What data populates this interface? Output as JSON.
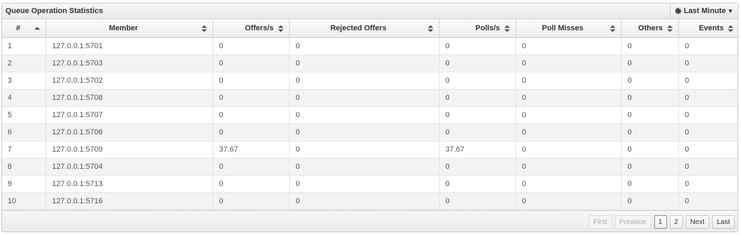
{
  "panel": {
    "title": "Queue Operation Statistics",
    "time_range": "Last Minute",
    "time_range_icon": "gear-icon"
  },
  "table": {
    "columns": [
      "#",
      "Member",
      "Offers/s",
      "Rejected Offers",
      "Polls/s",
      "Poll Misses",
      "Others",
      "Events"
    ],
    "rows": [
      [
        "1",
        "127.0.0.1:5701",
        "0",
        "0",
        "0",
        "0",
        "0",
        "0"
      ],
      [
        "2",
        "127.0.0.1:5703",
        "0",
        "0",
        "0",
        "0",
        "0",
        "0"
      ],
      [
        "3",
        "127.0.0.1:5702",
        "0",
        "0",
        "0",
        "0",
        "0",
        "0"
      ],
      [
        "4",
        "127.0.0.1:5708",
        "0",
        "0",
        "0",
        "0",
        "0",
        "0"
      ],
      [
        "5",
        "127.0.0.1:5707",
        "0",
        "0",
        "0",
        "0",
        "0",
        "0"
      ],
      [
        "6",
        "127.0.0.1:5706",
        "0",
        "0",
        "0",
        "0",
        "0",
        "0"
      ],
      [
        "7",
        "127.0.0.1:5709",
        "37.67",
        "0",
        "37.67",
        "0",
        "0",
        "0"
      ],
      [
        "8",
        "127.0.0.1:5704",
        "0",
        "0",
        "0",
        "0",
        "0",
        "0"
      ],
      [
        "9",
        "127.0.0.1:5713",
        "0",
        "0",
        "0",
        "0",
        "0",
        "0"
      ],
      [
        "10",
        "127.0.0.1:5716",
        "0",
        "0",
        "0",
        "0",
        "0",
        "0"
      ]
    ]
  },
  "pagination": {
    "first": "First",
    "previous": "Previous",
    "pages": [
      "1",
      "2"
    ],
    "current_page": "1",
    "next": "Next",
    "last": "Last"
  }
}
